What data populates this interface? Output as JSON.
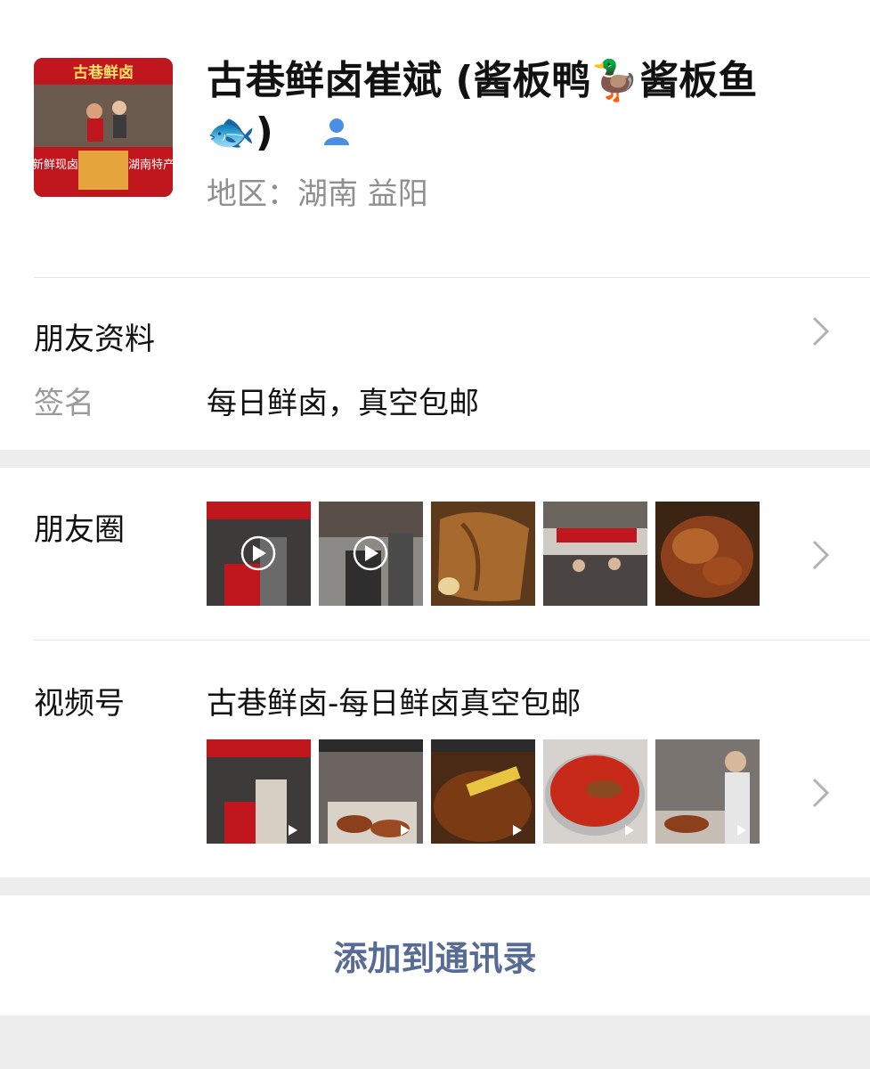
{
  "profile": {
    "name": "古巷鲜卤崔斌 (酱板鸭🦆酱板鱼🐟)",
    "region": "地区：湖南 益阳",
    "avatar_shop_sign": "古巷鲜卤",
    "avatar_left_banner": "新鲜现卤",
    "avatar_right_banner": "湖南特产"
  },
  "profile_section": {
    "title": "朋友资料",
    "signature_label": "签名",
    "signature_value": "每日鲜卤，真空包邮"
  },
  "moments": {
    "title": "朋友圈"
  },
  "channels": {
    "title": "视频号",
    "channel_name": "古巷鲜卤-每日鲜卤真空包邮"
  },
  "actions": {
    "add_contact": "添加到通讯录"
  },
  "colors": {
    "link_blue": "#576b95",
    "gender_icon_blue": "#4a90e2",
    "divider": "#e5e5e5"
  }
}
